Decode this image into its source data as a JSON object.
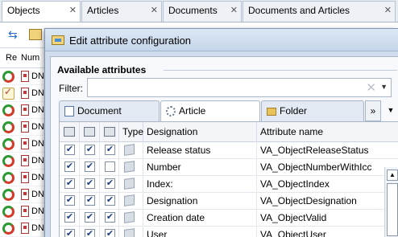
{
  "bg_tabs": [
    {
      "label": "Objects",
      "active": true
    },
    {
      "label": "Articles",
      "active": false
    },
    {
      "label": "Documents",
      "active": false
    },
    {
      "label": "Documents and Articles",
      "active": false
    }
  ],
  "bg_list": {
    "col_status": "Re",
    "col_number": "Num",
    "rows": [
      "DN",
      "DN",
      "DN",
      "DN",
      "DN",
      "DN",
      "DN",
      "DN",
      "DN",
      "DN"
    ]
  },
  "dialog": {
    "title": "Edit attribute configuration",
    "section_title": "Available attributes",
    "filter_label": "Filter:",
    "filter_value": "",
    "tabs": [
      {
        "label": "Document",
        "icon": "document-icon",
        "active": false
      },
      {
        "label": "Article",
        "icon": "gear-icon",
        "active": true
      },
      {
        "label": "Folder",
        "icon": "folder-icon",
        "active": false
      }
    ],
    "more_tabs_label": "»",
    "grid": {
      "headers": {
        "type": "Type",
        "designation": "Designation",
        "attribute_name": "Attribute name"
      },
      "rows": [
        {
          "c1": true,
          "c2": true,
          "c3": true,
          "designation": "Release status",
          "attribute": "VA_ObjectReleaseStatus"
        },
        {
          "c1": true,
          "c2": true,
          "c3": false,
          "designation": "Number",
          "attribute": "VA_ObjectNumberWithIcc"
        },
        {
          "c1": true,
          "c2": true,
          "c3": true,
          "designation": "Index:",
          "attribute": "VA_ObjectIndex"
        },
        {
          "c1": true,
          "c2": true,
          "c3": true,
          "designation": "Designation",
          "attribute": "VA_ObjectDesignation"
        },
        {
          "c1": true,
          "c2": true,
          "c3": true,
          "designation": "Creation date",
          "attribute": "VA_ObjectValid"
        },
        {
          "c1": true,
          "c2": true,
          "c3": true,
          "designation": "User",
          "attribute": "VA_ObjectUser"
        }
      ]
    }
  }
}
